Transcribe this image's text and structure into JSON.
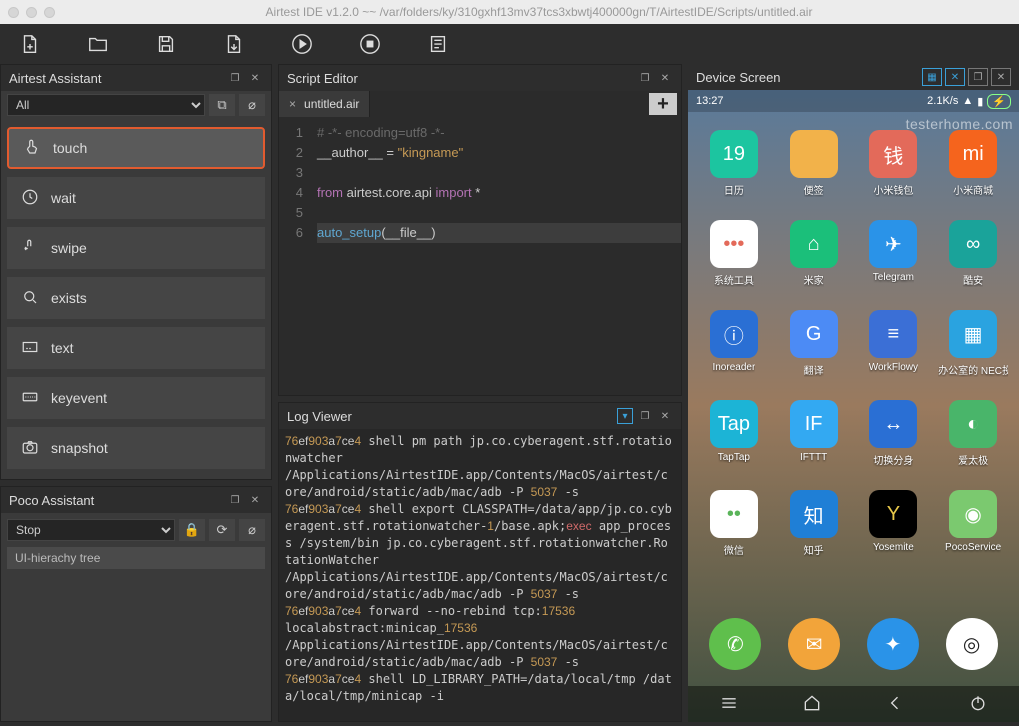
{
  "title": "Airtest IDE v1.2.0 ~~ /var/folders/ky/310gxhf13mv37tcs3xbwtj400000gn/T/AirtestIDE/Scripts/untitled.air",
  "panels": {
    "assistant": "Airtest Assistant",
    "assistant_filter": "All",
    "poco": "Poco Assistant",
    "poco_mode": "Stop",
    "tree": "UI-hierachy tree",
    "editor": "Script Editor",
    "tab": "untitled.air",
    "log": "Log Viewer",
    "device": "Device Screen"
  },
  "commands": [
    {
      "id": "touch",
      "label": "touch"
    },
    {
      "id": "wait",
      "label": "wait"
    },
    {
      "id": "swipe",
      "label": "swipe"
    },
    {
      "id": "exists",
      "label": "exists"
    },
    {
      "id": "text",
      "label": "text"
    },
    {
      "id": "keyevent",
      "label": "keyevent"
    },
    {
      "id": "snapshot",
      "label": "snapshot"
    }
  ],
  "code": {
    "lines": [
      "1",
      "2",
      "3",
      "4",
      "5",
      "6"
    ],
    "c1": "# -*- encoding=utf8 -*-",
    "c2a": "__author__ = ",
    "c2b": "\"kingname\"",
    "c4a": "from",
    "c4b": " airtest.core.api ",
    "c4c": "import",
    "c4d": " *",
    "c6a": "auto_setup",
    "c6b": "(__file__)"
  },
  "log": {
    "t1a": "76",
    "t1b": "ef",
    "t1c": "903",
    "t1d": "a",
    "t1e": "7",
    "t1f": "ce",
    "t1g": "4",
    "l1": " shell pm path jp.co.cyberagent.stf.rotationwatcher",
    "l2": "/Applications/AirtestIDE.app/Contents/MacOS/airtest/core/android/static/adb/mac/adb -P ",
    "p": "5037",
    "l2b": " -s",
    "l3": " shell export CLASSPATH=/data/app/jp.co.cyberagent.stf.rotationwatcher-",
    "one": "1",
    "l3b": "/base.apk;",
    "ex": "exec",
    "l3c": " app_process /system/bin jp.co.cyberagent.stf.rotationwatcher.RotationWatcher",
    "l4": " forward --no-rebind tcp:",
    "tcp": "17536",
    "l4b": "localabstract:minicap_",
    "tcp2": "17536",
    "l5": " shell LD_LIBRARY_PATH=/data/local/tmp /data/local/tmp/minicap -i"
  },
  "device": {
    "time": "13:27",
    "net": "2.1K/s",
    "watermark": "testerhome.com",
    "apps": [
      {
        "bg": "#1cc5a0",
        "txt": "19",
        "lbl": "日历"
      },
      {
        "bg": "#f2b24a",
        "txt": "",
        "lbl": "便签"
      },
      {
        "bg": "#e36a5a",
        "txt": "钱",
        "lbl": "小米钱包"
      },
      {
        "bg": "#f5641d",
        "txt": "mi",
        "lbl": "小米商城"
      },
      {
        "bg": "#ffffff",
        "txt": "•••",
        "lbl": "系统工具",
        "fg": "#e36a5a"
      },
      {
        "bg": "#1bbf7a",
        "txt": "⌂",
        "lbl": "米家"
      },
      {
        "bg": "#2a93e8",
        "txt": "✈",
        "lbl": "Telegram"
      },
      {
        "bg": "#1aa39a",
        "txt": "∞",
        "lbl": "酷安"
      },
      {
        "bg": "#2a6fd4",
        "txt": "ⓘ",
        "lbl": "Inoreader"
      },
      {
        "bg": "#4c8bf5",
        "txt": "G",
        "lbl": "翻译"
      },
      {
        "bg": "#3b6fd6",
        "txt": "≡",
        "lbl": "WorkFlowy"
      },
      {
        "bg": "#2aa3e0",
        "txt": "▦",
        "lbl": "办公室的 NEC投影仪"
      },
      {
        "bg": "#1cb4d6",
        "txt": "Tap",
        "lbl": "TapTap"
      },
      {
        "bg": "#33a9f2",
        "txt": "IF",
        "lbl": "IFTTT"
      },
      {
        "bg": "#2a6fd4",
        "txt": "↔",
        "lbl": "切换分身"
      },
      {
        "bg": "#49b56a",
        "txt": "◐",
        "lbl": "爱太极"
      },
      {
        "bg": "#ffffff",
        "txt": "••",
        "lbl": "微信",
        "fg": "#5ab45a"
      },
      {
        "bg": "#1f7fd6",
        "txt": "知",
        "lbl": "知乎"
      },
      {
        "bg": "#000000",
        "txt": "Y",
        "lbl": "Yosemite",
        "fg": "#e8c84a"
      },
      {
        "bg": "#7bc96f",
        "txt": "◉",
        "lbl": "PocoService"
      }
    ],
    "dock": [
      {
        "bg": "#5fbf4c",
        "txt": "✆"
      },
      {
        "bg": "#f2a43a",
        "txt": "✉"
      },
      {
        "bg": "#2a93e8",
        "txt": "✦"
      },
      {
        "bg": "#ffffff",
        "txt": "◎",
        "fg": "#222"
      }
    ]
  }
}
